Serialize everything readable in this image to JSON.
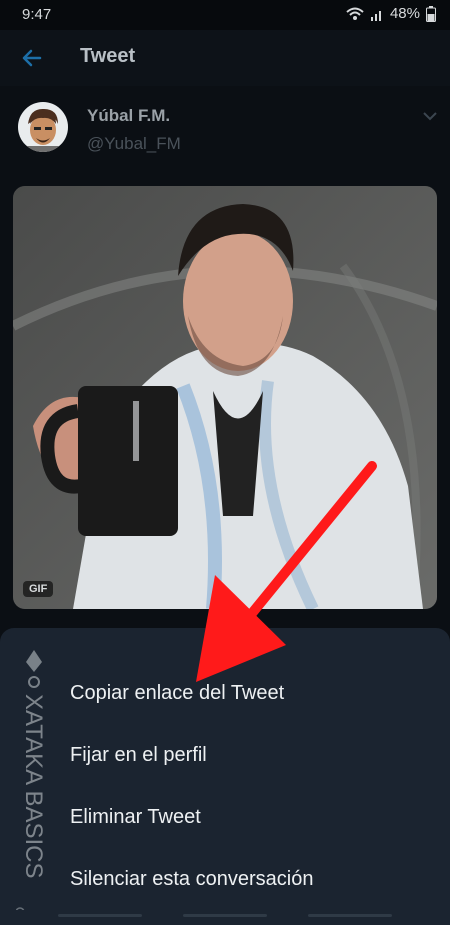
{
  "status_bar": {
    "time": "9:47",
    "battery": "48%"
  },
  "header": {
    "title": "Tweet"
  },
  "tweet": {
    "author_name": "Yúbal F.M.",
    "author_handle": "@Yubal_FM",
    "media_badge": "GIF"
  },
  "menu": {
    "items": [
      "Copiar enlace del Tweet",
      "Fijar en el perfil",
      "Eliminar Tweet",
      "Silenciar esta conversación"
    ]
  },
  "watermark": {
    "text": "XATAKA BASICS"
  },
  "colors": {
    "accent": "#1d9bf0",
    "sheet": "#1b2430",
    "arrow": "#ff1a1a"
  }
}
